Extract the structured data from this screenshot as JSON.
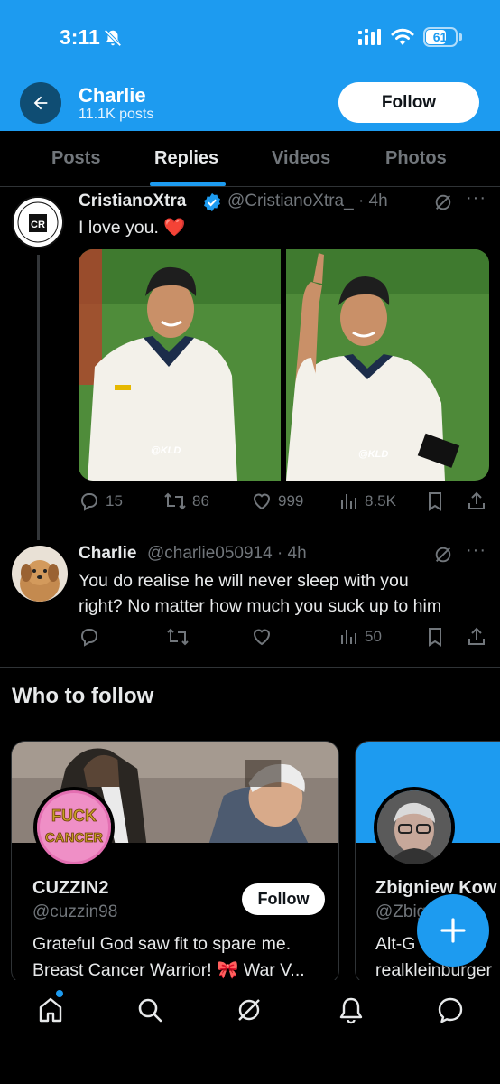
{
  "status_bar": {
    "time": "3:11",
    "battery": "61"
  },
  "header": {
    "name": "Charlie",
    "posts": "11.1K posts",
    "follow_label": "Follow"
  },
  "tabs": [
    {
      "label": "Posts"
    },
    {
      "label": "Replies",
      "active": true
    },
    {
      "label": "Videos"
    },
    {
      "label": "Photos"
    }
  ],
  "tweet1": {
    "name": "CristianoXtra",
    "handle": "@CristianoXtra_ · 4h",
    "text": "I love you. ❤️",
    "media_watermark": "@KLD",
    "stats": {
      "replies": "15",
      "reposts": "86",
      "likes": "999",
      "views": "8.5K"
    }
  },
  "tweet2": {
    "name": "Charlie",
    "handle": "@charlie050914 · 4h",
    "text_line1": "You do realise he will never sleep with you",
    "text_line2": "right? No matter how much you suck up to him",
    "stats": {
      "views": "50"
    }
  },
  "who_to_follow": {
    "title": "Who to follow",
    "cards": [
      {
        "name": "CUZZIN2",
        "handle": "@cuzzin98",
        "bio_line1": "Grateful God saw fit to spare me.",
        "bio_line2": "Breast Cancer Warrior! 🎀 War V...",
        "follow_label": "Follow",
        "avatar_text_1": "FUCK",
        "avatar_text_2": "CANCER"
      },
      {
        "name": "Zbigniew Kow",
        "handle": "@Zbig   84",
        "bio_line1": "Alt-G       lle",
        "bio_line2": "realkleinburger"
      }
    ]
  },
  "colors": {
    "accent": "#1d9bf0",
    "background": "#000000",
    "muted": "#71767b",
    "text": "#e7e9ea"
  },
  "icons": {
    "back": "arrow-left-icon",
    "verified": "verified-badge-icon",
    "grok": "grok-icon",
    "reply": "reply-icon",
    "repost": "repost-icon",
    "like": "heart-icon",
    "views": "views-icon",
    "bookmark": "bookmark-icon",
    "share": "share-icon",
    "compose": "plus-icon",
    "nav": [
      "home-icon",
      "search-icon",
      "grok-icon",
      "notifications-icon",
      "messages-icon"
    ]
  }
}
